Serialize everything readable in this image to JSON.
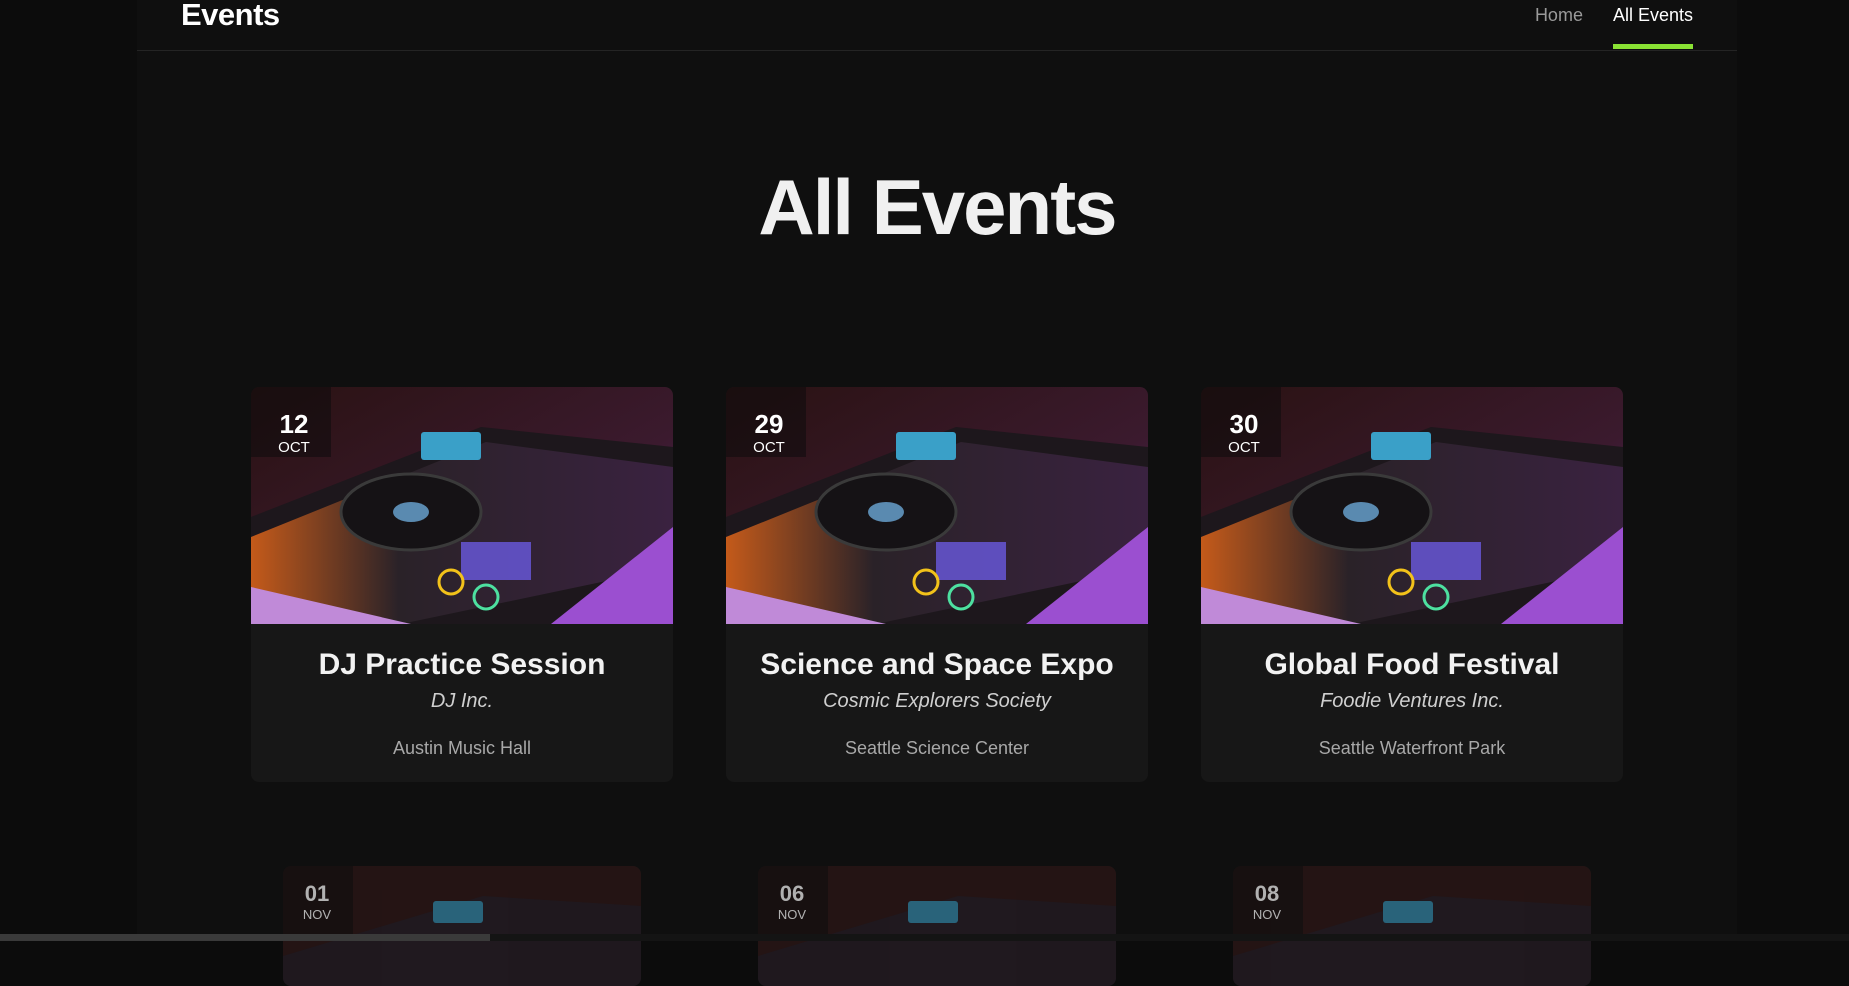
{
  "navbar": {
    "brand": "Events",
    "links": [
      {
        "label": "Home",
        "active": false
      },
      {
        "label": "All Events",
        "active": true
      }
    ],
    "accent_color": "#8ae234"
  },
  "main": {
    "title": "All Events"
  },
  "events": [
    {
      "day": "12",
      "month": "OCT",
      "title": "DJ Practice Session",
      "organizer": "DJ Inc.",
      "venue": "Austin Music Hall"
    },
    {
      "day": "29",
      "month": "OCT",
      "title": "Science and Space Expo",
      "organizer": "Cosmic Explorers Society",
      "venue": "Seattle Science Center"
    },
    {
      "day": "30",
      "month": "OCT",
      "title": "Global Food Festival",
      "organizer": "Foodie Ventures Inc.",
      "venue": "Seattle Waterfront Park"
    },
    {
      "day": "01",
      "month": "NOV"
    },
    {
      "day": "06",
      "month": "NOV"
    },
    {
      "day": "08",
      "month": "NOV"
    }
  ]
}
